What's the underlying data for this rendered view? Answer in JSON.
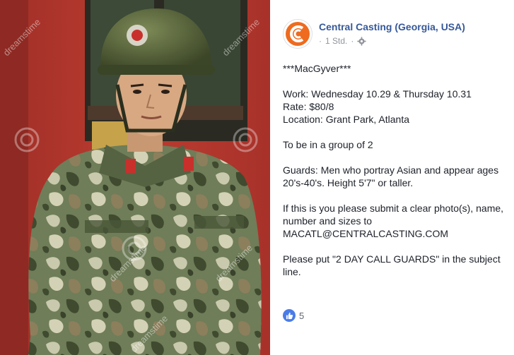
{
  "post": {
    "page_name": "Central Casting (Georgia, USA)",
    "timestamp": "1 Std.",
    "separator": "·",
    "lines": [
      "***MacGyver***",
      "Work: Wednesday 10.29 & Thursday 10.31",
      "Rate: $80/8",
      "Location: Grant Park, Atlanta",
      "To be in a group of 2",
      "Guards: Men who portray Asian and appear ages 20's-40's. Height 5'7\" or taller.",
      "If this is you please submit a clear photo(s), name, number and sizes to",
      "MACATL@CENTRALCASTING.COM",
      "Please put \"2 DAY CALL GUARDS\" in the subject line."
    ],
    "reaction_count": "5"
  },
  "watermark": {
    "text": "dreamstime"
  },
  "colors": {
    "brand_orange": "#ee6b1f",
    "link_blue": "#365899",
    "like_blue": "#4a7ce8",
    "wall_red": "#b5372c"
  },
  "icons": {
    "avatar": "central-casting-logo",
    "privacy": "gear-icon",
    "reaction": "thumbs-up-icon"
  }
}
